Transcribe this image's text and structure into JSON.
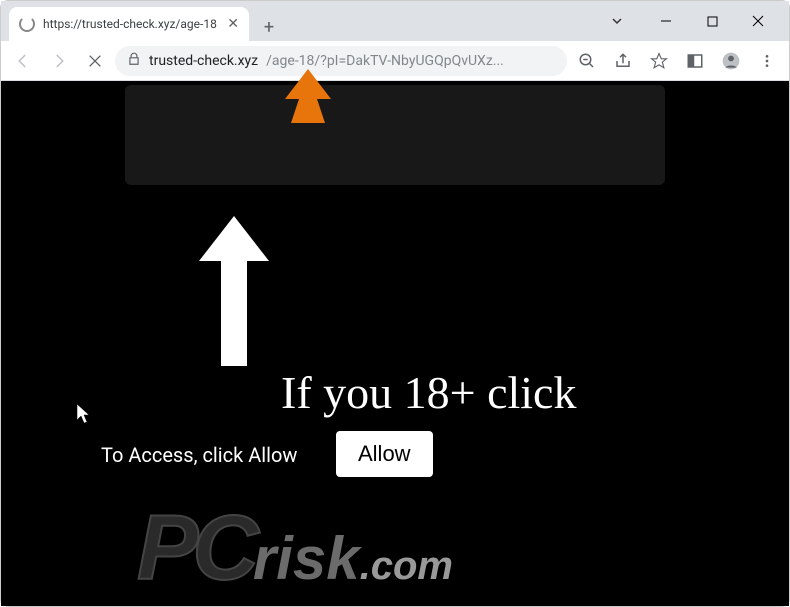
{
  "browser": {
    "tab_title": "https://trusted-check.xyz/age-18",
    "url_domain": "trusted-check.xyz",
    "url_path": "/age-18/?pI=DakTV-NbyUGQpQvUXz...",
    "new_tab": "+"
  },
  "window": {
    "minimize": "—",
    "maximize": "□",
    "close": "✕"
  },
  "page": {
    "headline": "If you 18+ click",
    "subtext": "To Access, click Allow",
    "allow_button": "Allow"
  },
  "watermark": {
    "pc": "PC",
    "risk": "risk",
    "com": ".com"
  }
}
